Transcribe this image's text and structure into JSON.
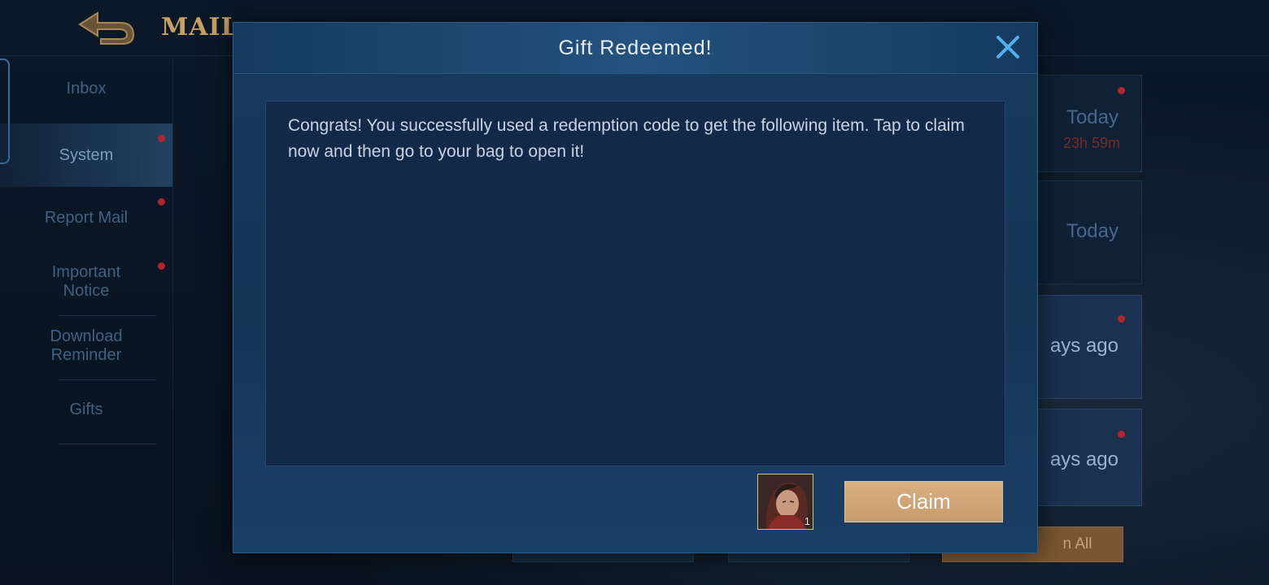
{
  "background": {
    "title": "MAIL",
    "sidebar": {
      "items": [
        {
          "label": "Inbox"
        },
        {
          "label": "System"
        },
        {
          "label": "Report Mail"
        },
        {
          "label": "Important Notice"
        },
        {
          "label": "Download Reminder"
        },
        {
          "label": "Gifts"
        }
      ]
    },
    "cards": [
      {
        "date": "Today",
        "timer": "23h 59m"
      },
      {
        "date": "Today"
      },
      {
        "date": "ays ago"
      },
      {
        "date": "ays ago"
      }
    ],
    "claim_all_label": "n All"
  },
  "modal": {
    "title": "Gift Redeemed!",
    "message": "Congrats! You successfully used a redemption code to get the following item. Tap to claim now and then go to your bag to open it!",
    "item": {
      "quantity": "1",
      "icon": "hero-portrait-icon"
    },
    "claim_label": "Claim",
    "close_icon": "close-icon"
  },
  "colors": {
    "accent_gold": "#c9a064",
    "claim_button": "#d4a878",
    "close_icon": "#4fb0f2",
    "notification_dot": "#b2262b"
  }
}
